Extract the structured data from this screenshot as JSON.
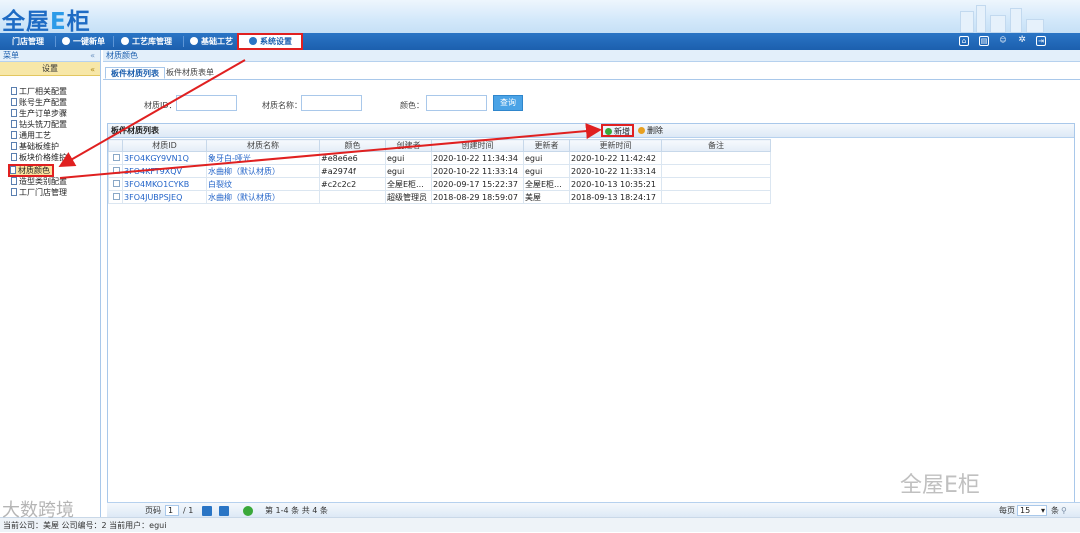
{
  "app": {
    "logo_main": "全屋",
    "logo_e": "E",
    "logo_tail": "柜"
  },
  "nav": {
    "items": [
      {
        "label": "门店管理"
      },
      {
        "label": "一键新单"
      },
      {
        "label": "工艺库管理"
      },
      {
        "label": "基础工艺"
      },
      {
        "label": "系统设置"
      }
    ]
  },
  "toolbar_icons": [
    "home-icon",
    "book-icon",
    "user-icon",
    "gear-icon",
    "exit-icon"
  ],
  "sidebar": {
    "header": "菜单",
    "collapse": "«",
    "section": "设置",
    "section_toggle": "«",
    "items": [
      {
        "label": "工厂相关配置"
      },
      {
        "label": "账号生产配置"
      },
      {
        "label": "生产订单步骤"
      },
      {
        "label": "钻头铣刀配置"
      },
      {
        "label": "通用工艺"
      },
      {
        "label": "基础板维护"
      },
      {
        "label": "板块价格维护"
      },
      {
        "label": "材质颜色"
      },
      {
        "label": "造型类别配置"
      },
      {
        "label": "工厂门店管理"
      }
    ]
  },
  "main": {
    "breadcrumb": "材质颜色",
    "tabs": [
      {
        "label": "板件材质列表"
      },
      {
        "label": "板件材质表单"
      }
    ],
    "filters": {
      "id_label": "材质ID：",
      "name_label": "材质名称：",
      "color_label": "颜色：",
      "search_label": "查询"
    },
    "grid": {
      "title": "板件材质列表",
      "add_label": "新增",
      "delete_label": "删除",
      "columns": [
        "材质ID",
        "材质名称",
        "颜色",
        "创建者",
        "创建时间",
        "更新者",
        "更新时间",
        "备注"
      ],
      "rows": [
        [
          "3FO4KGY9VN1Q",
          "象牙白-哑光",
          "#e8e6e6",
          "egui",
          "2020-10-22 11:34:34",
          "egui",
          "2020-10-22 11:42:42",
          ""
        ],
        [
          "3FO4KFT9XQV",
          "水曲柳（默认材质）",
          "#a2974f",
          "egui",
          "2020-10-22 11:33:14",
          "egui",
          "2020-10-22 11:33:14",
          ""
        ],
        [
          "3FO4MKO1CYKB",
          "白裂纹",
          "#c2c2c2",
          "全屋E柜...",
          "2020-09-17 15:22:37",
          "全屋E柜...",
          "2020-10-13 10:35:21",
          ""
        ],
        [
          "3FO4JUBPSJEQ",
          "水曲柳（默认材质）",
          "",
          "超级管理员",
          "2018-08-29 18:59:07",
          "美屋",
          "2018-09-13 18:24:17",
          ""
        ]
      ]
    }
  },
  "pager": {
    "page_label": "页码",
    "page_value": "1",
    "of_label": "/ 1",
    "summary": "第 1-4 条  共 4 条",
    "per_page_label": "每页",
    "per_page_value": "15",
    "unit": "条"
  },
  "status": {
    "text": "当前公司：美屋   公司编号：2   当前用户：egui"
  },
  "watermarks": {
    "left": "大数跨境",
    "right": "全屋E柜"
  },
  "colors": {
    "nav": "#1c5fae",
    "highlight": "#e02020",
    "link": "#2465c9"
  }
}
